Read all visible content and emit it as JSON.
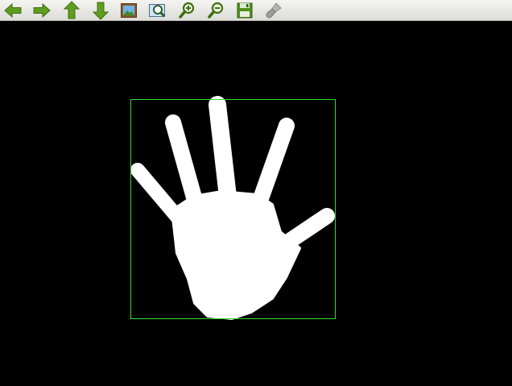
{
  "toolbar": {
    "buttons": [
      {
        "name": "pan-left",
        "icon": "arrow-left-icon"
      },
      {
        "name": "pan-right",
        "icon": "arrow-right-icon"
      },
      {
        "name": "pan-up",
        "icon": "arrow-up-icon"
      },
      {
        "name": "pan-down",
        "icon": "arrow-down-icon"
      },
      {
        "name": "fit-image",
        "icon": "image-frame-icon"
      },
      {
        "name": "zoom-region",
        "icon": "zoom-window-icon"
      },
      {
        "name": "zoom-in",
        "icon": "zoom-in-icon"
      },
      {
        "name": "zoom-out",
        "icon": "zoom-out-icon"
      },
      {
        "name": "save",
        "icon": "save-disk-icon"
      },
      {
        "name": "properties",
        "icon": "brush-icon"
      }
    ],
    "colors": {
      "arrow": "#5f9d1f",
      "arrow_dark": "#3f6f10",
      "disabled": "#a8a8a8"
    }
  },
  "image_view": {
    "background": "#000000",
    "hand_color": "#ffffff",
    "bounding_box_color": "#33dd33"
  }
}
